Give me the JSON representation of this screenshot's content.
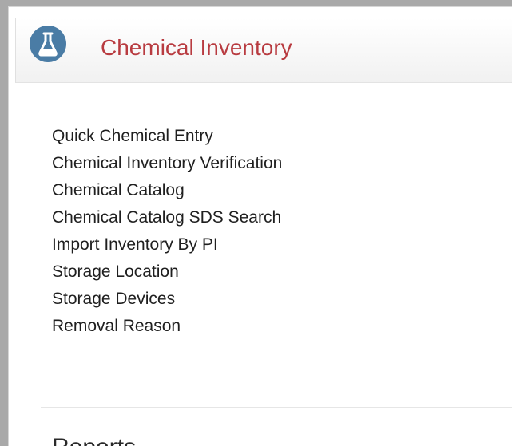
{
  "header": {
    "title": "Chemical Inventory",
    "icon": "flask-icon",
    "title_color": "#b83b40",
    "icon_color": "#4a7ca5"
  },
  "menu": {
    "items": [
      {
        "label": "Quick Chemical Entry"
      },
      {
        "label": "Chemical Inventory Verification"
      },
      {
        "label": "Chemical Catalog"
      },
      {
        "label": "Chemical Catalog SDS Search"
      },
      {
        "label": "Import Inventory By PI"
      },
      {
        "label": "Storage Location"
      },
      {
        "label": "Storage Devices"
      },
      {
        "label": "Removal Reason"
      }
    ]
  },
  "sections": {
    "reports_heading": "Reports"
  }
}
